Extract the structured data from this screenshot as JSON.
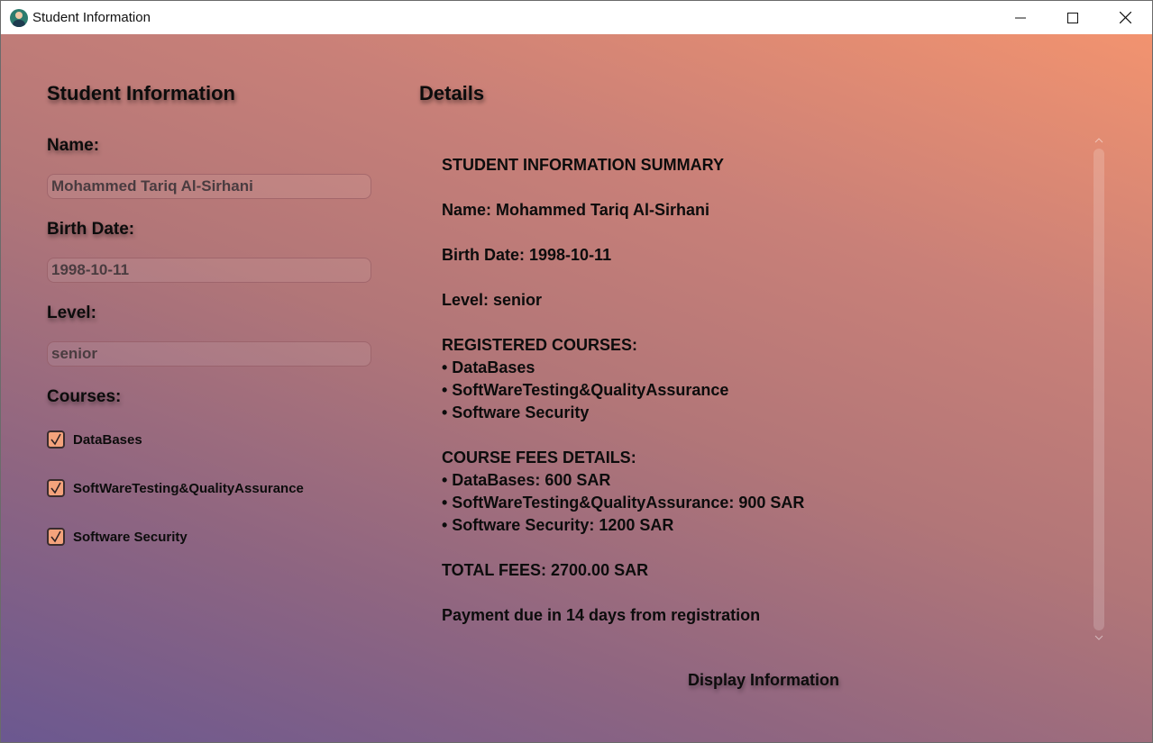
{
  "window": {
    "title": "Student Information",
    "icon": "student-avatar-icon"
  },
  "left": {
    "heading": "Student Information",
    "name_label": "Name:",
    "name_value": "Mohammed Tariq Al-Sirhani",
    "birth_label": "Birth Date:",
    "birth_value": "1998-10-11",
    "level_label": "Level:",
    "level_value": "senior",
    "courses_label": "Courses:",
    "courses": [
      {
        "label": "DataBases",
        "checked": true
      },
      {
        "label": "SoftWareTesting&QualityAssurance",
        "checked": true
      },
      {
        "label": "Software Security",
        "checked": true
      }
    ]
  },
  "right": {
    "heading": "Details",
    "summary_lines": [
      "STUDENT INFORMATION SUMMARY",
      "",
      "Name: Mohammed Tariq Al-Sirhani",
      "",
      "Birth Date: 1998-10-11",
      "",
      "Level: senior",
      "",
      "REGISTERED COURSES:",
      "• DataBases",
      "• SoftWareTesting&QualityAssurance",
      "• Software Security",
      "",
      "COURSE FEES DETAILS:",
      "• DataBases: 600 SAR",
      "• SoftWareTesting&QualityAssurance: 900 SAR",
      "• Software Security: 1200 SAR",
      "",
      "TOTAL FEES: 2700.00 SAR",
      "",
      "Payment due in 14 days from registration"
    ],
    "display_button": "Display Information"
  },
  "colors": {
    "gradient_top_right": "#f2936f",
    "gradient_bottom_left": "#6b5890",
    "checkbox_fill": "#f4a37c"
  }
}
